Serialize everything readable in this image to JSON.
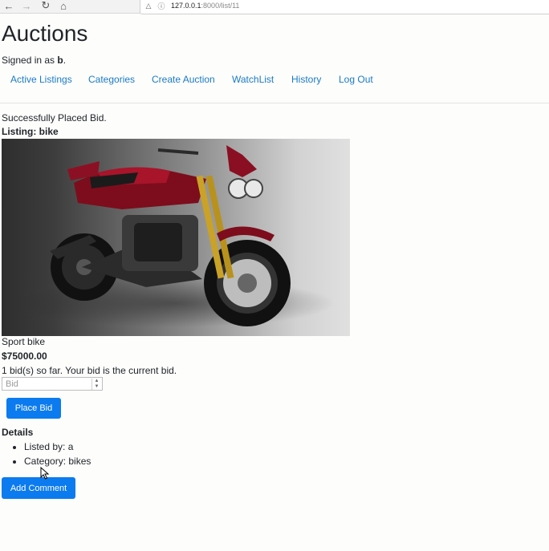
{
  "browser": {
    "url_host": "127.0.0.1",
    "url_path": ":8000/list/11",
    "icons": [
      "back-icon",
      "forward-icon",
      "reload-icon",
      "home-icon",
      "shield-icon",
      "info-icon"
    ]
  },
  "header": {
    "title": "Auctions",
    "signed_in_prefix": "Signed in as",
    "username": "b",
    "signed_in_suffix": "."
  },
  "nav": {
    "items": [
      {
        "label": "Active Listings"
      },
      {
        "label": "Categories"
      },
      {
        "label": "Create Auction"
      },
      {
        "label": "WatchList"
      },
      {
        "label": "History"
      },
      {
        "label": "Log Out"
      }
    ]
  },
  "listing": {
    "message": "Successfully Placed Bid.",
    "heading": "Listing: bike",
    "description": "Sport bike",
    "price": "$75000.00",
    "bid_status": "1 bid(s) so far. Your bid is the current bid.",
    "bid_placeholder": "Bid",
    "place_bid_label": "Place Bid",
    "details_heading": "Details",
    "details": [
      {
        "text": "Listed by: a"
      },
      {
        "text": "Category: bikes"
      }
    ],
    "add_comment_label": "Add Comment"
  },
  "colors": {
    "link": "#1a7bc4",
    "button": "#0b7bef"
  }
}
